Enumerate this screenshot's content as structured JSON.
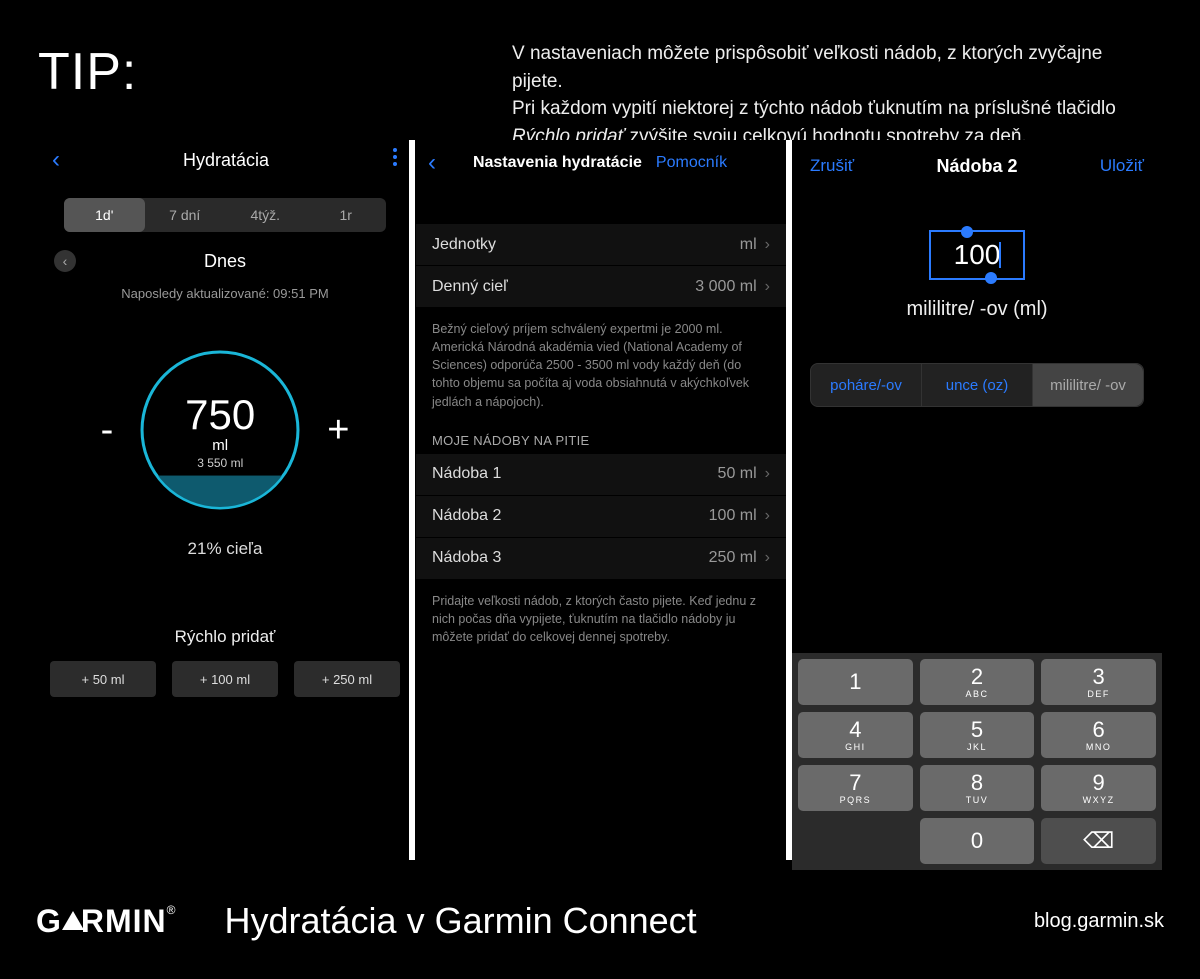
{
  "tip_label": "TIP:",
  "tip_text_1": "V nastaveniach môžete prispôsobiť veľkosti nádob, z ktorých zvyčajne pijete.",
  "tip_text_2a": "Pri každom vypití niektorej z týchto nádob ťuknutím na príslušné tlačidlo ",
  "tip_text_2b": "Rýchlo pridať",
  "tip_text_2c": " zvýšite svoju celkovú hodnotu spotreby za deň.",
  "phone1": {
    "title": "Hydratácia",
    "tabs": [
      "1d'",
      "7 dní",
      "4týž.",
      "1r"
    ],
    "day_label": "Dnes",
    "last_updated": "Naposledy aktualizované: 09:51 PM",
    "minus": "-",
    "plus": "+",
    "value": "750",
    "unit": "ml",
    "goal": "3 550 ml",
    "percent": "21% cieľa",
    "quick_add_label": "Rýchlo pridať",
    "quick_buttons": [
      "+ 50 ml",
      "+ 100 ml",
      "+ 250 ml"
    ]
  },
  "phone2": {
    "title": "Nastavenia hydratácie",
    "help": "Pomocník",
    "rows_top": [
      {
        "label": "Jednotky",
        "value": "ml"
      },
      {
        "label": "Denný cieľ",
        "value": "3 000 ml"
      }
    ],
    "info1": "Bežný cieľový príjem schválený expertmi je 2000 ml. Americká Národná akadémia vied (National Academy of Sciences) odporúča 2500 - 3500 ml vody každý deň (do tohto objemu sa počíta aj voda obsiahnutá v akýchkoľvek jedlách a nápojoch).",
    "section": "MOJE NÁDOBY NA PITIE",
    "containers": [
      {
        "label": "Nádoba 1",
        "value": "50 ml"
      },
      {
        "label": "Nádoba 2",
        "value": "100 ml"
      },
      {
        "label": "Nádoba 3",
        "value": "250 ml"
      }
    ],
    "info2": "Pridajte veľkosti nádob, z ktorých často pijete. Keď jednu z nich počas dňa vypijete, ťuknutím na tlačidlo nádoby ju môžete pridať do celkovej dennej spotreby."
  },
  "phone3": {
    "cancel": "Zrušiť",
    "title": "Nádoba 2",
    "save": "Uložiť",
    "value": "100",
    "unit_label": "mililitre/ -ov (ml)",
    "units": [
      "poháre/-ov",
      "unce (oz)",
      "mililitre/ -ov"
    ],
    "keys": [
      {
        "n": "1",
        "s": ""
      },
      {
        "n": "2",
        "s": "ABC"
      },
      {
        "n": "3",
        "s": "DEF"
      },
      {
        "n": "4",
        "s": "GHI"
      },
      {
        "n": "5",
        "s": "JKL"
      },
      {
        "n": "6",
        "s": "MNO"
      },
      {
        "n": "7",
        "s": "PQRS"
      },
      {
        "n": "8",
        "s": "TUV"
      },
      {
        "n": "9",
        "s": "WXYZ"
      },
      {
        "n": "",
        "s": ""
      },
      {
        "n": "0",
        "s": ""
      },
      {
        "n": "⌫",
        "s": ""
      }
    ]
  },
  "footer": {
    "brand": "GARMIN",
    "title": "Hydratácia v Garmin Connect",
    "url": "blog.garmin.sk"
  }
}
